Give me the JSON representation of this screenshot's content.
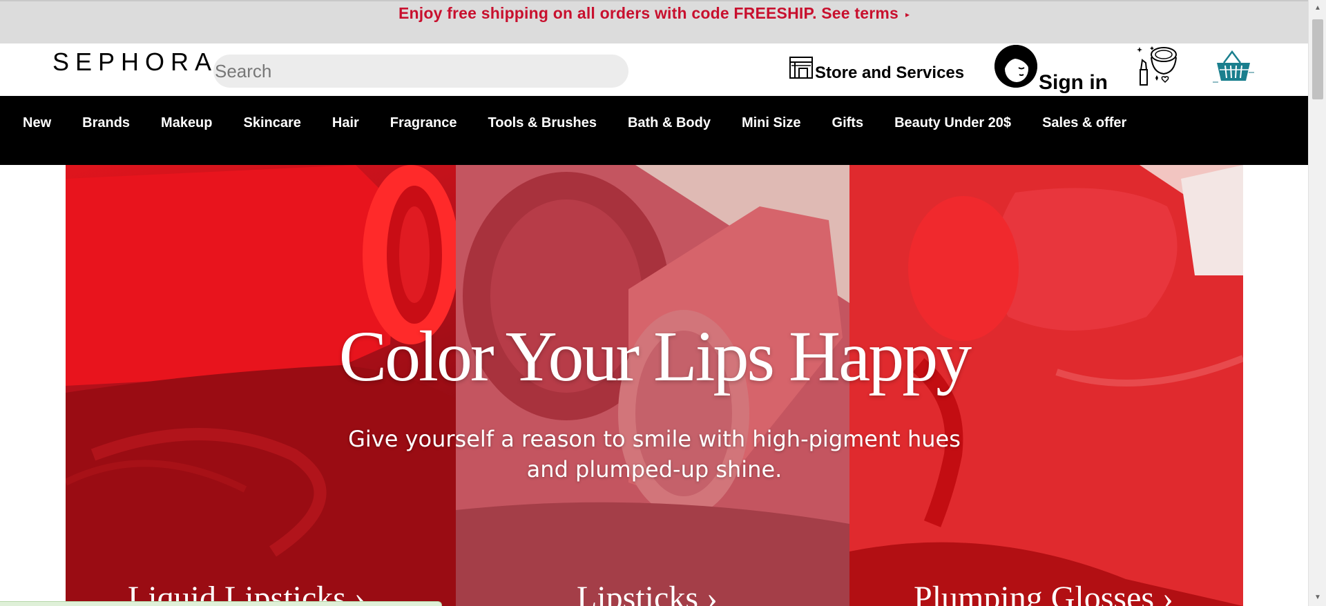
{
  "promo": {
    "text": "Enjoy free shipping on all orders with code FREESHIP. See terms",
    "arrow": "▸"
  },
  "header": {
    "logo": "SEPHORA",
    "search_placeholder": "Search",
    "store_label": "Store and Services",
    "signin_label": "Sign in"
  },
  "nav": {
    "items": [
      {
        "label": "New"
      },
      {
        "label": "Brands"
      },
      {
        "label": "Makeup"
      },
      {
        "label": "Skincare"
      },
      {
        "label": "Hair"
      },
      {
        "label": "Fragrance"
      },
      {
        "label": "Tools & Brushes"
      },
      {
        "label": "Bath & Body"
      },
      {
        "label": "Mini Size"
      },
      {
        "label": "Gifts"
      },
      {
        "label": "Beauty Under 20$"
      },
      {
        "label": "Sales & offer"
      }
    ]
  },
  "hero": {
    "title": "Color Your Lips Happy",
    "subtitle_line1": "Give yourself a reason to smile with high-pigment hues",
    "subtitle_line2": "and plumped-up shine.",
    "links": [
      {
        "label": "Liquid Lipsticks ›"
      },
      {
        "label": "Lipsticks ›"
      },
      {
        "label": "Plumping Glosses ›"
      }
    ]
  },
  "colors": {
    "promo_text": "#c8102e",
    "promo_bg": "#dcdcdc",
    "nav_bg": "#000000",
    "basket": "#1a7f8e"
  }
}
